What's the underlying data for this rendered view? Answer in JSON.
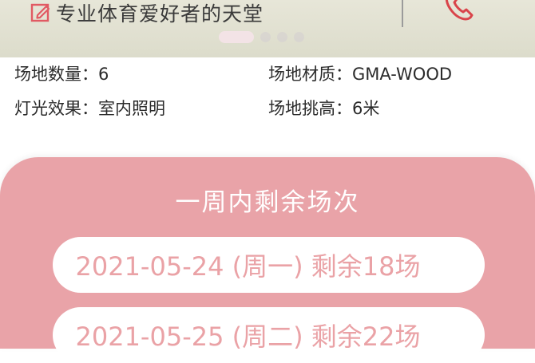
{
  "banner": {
    "tagline": "专业体育爱好者的天堂",
    "slides_total": 4,
    "active_slide": 1
  },
  "info": {
    "court_count": "场地数量：6",
    "court_material": "场地材质：GMA-WOOD",
    "lighting": "灯光效果：室内照明",
    "ceiling_height": "场地挑高：6米"
  },
  "sessions": {
    "title": "一周内剩余场次",
    "days": [
      {
        "label": "2021-05-24 (周一) 剩余18场"
      },
      {
        "label": "2021-05-25 (周二) 剩余22场"
      }
    ]
  },
  "colors": {
    "card_bg": "#e9a3a8",
    "pill_text": "#eaa2a6",
    "phone_icon": "#d9444a",
    "edit_icon": "#e15a63"
  },
  "icons": {
    "edit": "edit-icon",
    "phone": "phone-icon"
  }
}
